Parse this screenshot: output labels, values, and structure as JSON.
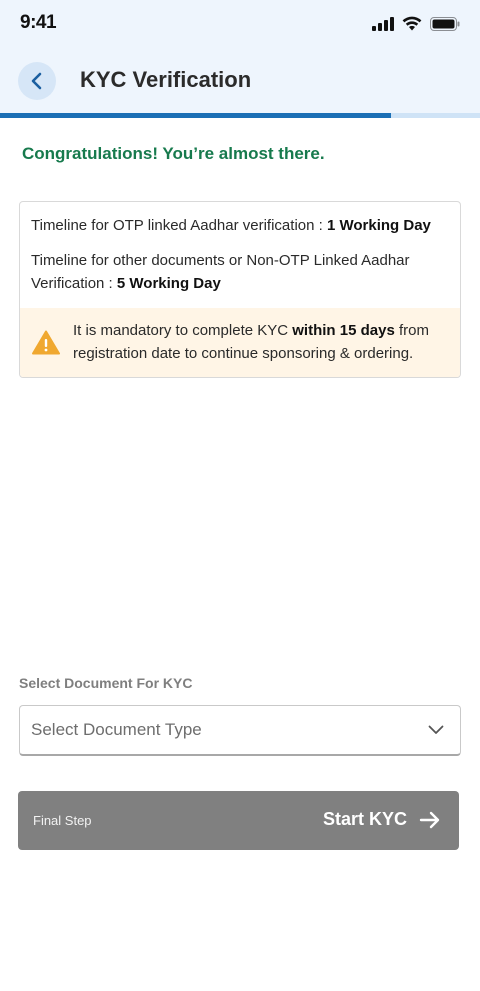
{
  "status_bar": {
    "time": "9:41"
  },
  "header": {
    "title": "KYC Verification"
  },
  "progress": {
    "fraction": 0.815
  },
  "congrats_text": "Congratulations! You’re almost there.",
  "timeline": {
    "otp_prefix": "Timeline for OTP linked Aadhar verification : ",
    "otp_value": "1 Working Day",
    "other_prefix": "Timeline for other documents or Non-OTP Linked Aadhar Verification : ",
    "other_value": "5 Working Day"
  },
  "warning": {
    "prefix": "It is mandatory to complete KYC ",
    "emphasis": "within 15 days",
    "suffix": " from registration date to continue sponsoring & ordering."
  },
  "document_select": {
    "label": "Select Document For KYC",
    "placeholder": "Select Document Type"
  },
  "start_button": {
    "hint": "Final Step",
    "label": "Start KYC"
  },
  "colors": {
    "accent": "#1b6fb5",
    "success": "#177a4d",
    "warning": "#f0a830",
    "button_disabled": "#808080"
  }
}
